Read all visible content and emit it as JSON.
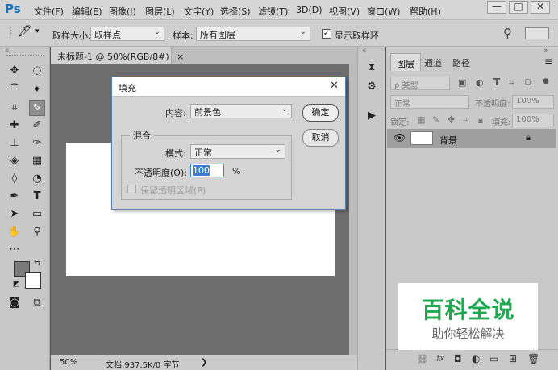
{
  "app": {
    "logo": "Ps"
  },
  "menu": [
    "文件(F)",
    "编辑(E)",
    "图像(I)",
    "图层(L)",
    "文字(Y)",
    "选择(S)",
    "滤镜(T)",
    "3D(D)",
    "视图(V)",
    "窗口(W)",
    "帮助(H)"
  ],
  "window_controls": {
    "minimize": "—",
    "maximize": "□",
    "close": "✕"
  },
  "options": {
    "sample_size_label": "取样大小:",
    "sample_size_value": "取样点",
    "sample_label": "样本:",
    "sample_value": "所有图层",
    "show_ring_label": "显示取样环",
    "show_ring_checked": "✓"
  },
  "document": {
    "tab_title": "未标题-1 @ 50%(RGB/8#)",
    "tab_close": "×",
    "zoom": "50%",
    "doc_info": "文档:937.5K/0 字节",
    "status_arrow": "❯"
  },
  "layers_panel": {
    "tabs": [
      "图层",
      "通道",
      "路径"
    ],
    "filter_kind": "ρ 类型",
    "blend_mode": "正常",
    "opacity_label": "不透明度:",
    "opacity_value": "100%",
    "lock_label": "锁定:",
    "fill_label": "填充:",
    "fill_value": "100%",
    "layer_name": "背景"
  },
  "fill_dialog": {
    "title": "填充",
    "close": "✕",
    "contents_label": "内容:",
    "contents_value": "前景色",
    "blending_group": "混合",
    "mode_label": "模式:",
    "mode_value": "正常",
    "opacity_label": "不透明度(O):",
    "opacity_value": "100",
    "percent": "%",
    "preserve_transparency_label": "保留透明区域(P)",
    "ok": "确定",
    "cancel": "取消"
  },
  "watermark": {
    "main": "百科全说",
    "sub": "助你轻松解决"
  },
  "colors": {
    "foreground": "#7a7a7a",
    "background": "#ffffff",
    "accent": "#1fa84f",
    "selection_blue": "#3c7fd1"
  }
}
